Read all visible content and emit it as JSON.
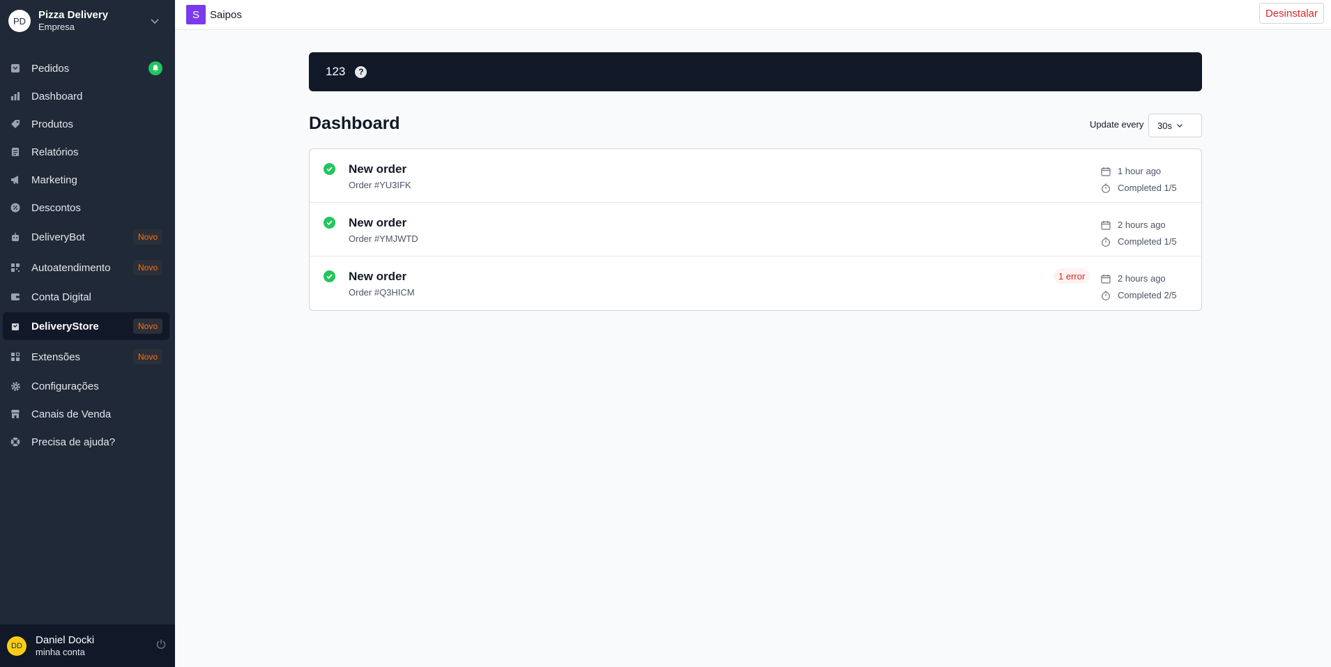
{
  "company": {
    "initials": "PD",
    "name": "Pizza Delivery",
    "subtitle": "Empresa"
  },
  "sidebar": {
    "items": [
      {
        "label": "Pedidos",
        "icon": "inbox-icon",
        "badge": ""
      },
      {
        "label": "Dashboard",
        "icon": "bar-chart-icon",
        "badge": ""
      },
      {
        "label": "Produtos",
        "icon": "tag-icon",
        "badge": ""
      },
      {
        "label": "Relatórios",
        "icon": "document-icon",
        "badge": ""
      },
      {
        "label": "Marketing",
        "icon": "megaphone-icon",
        "badge": ""
      },
      {
        "label": "Descontos",
        "icon": "discount-icon",
        "badge": ""
      },
      {
        "label": "DeliveryBot",
        "icon": "bot-icon",
        "badge": "Novo"
      },
      {
        "label": "Autoatendimento",
        "icon": "qrcode-icon",
        "badge": "Novo"
      },
      {
        "label": "Conta Digital",
        "icon": "wallet-icon",
        "badge": ""
      },
      {
        "label": "DeliveryStore",
        "icon": "store-bag-icon",
        "badge": "Novo"
      },
      {
        "label": "Extensões",
        "icon": "puzzle-icon",
        "badge": "Novo"
      },
      {
        "label": "Configurações",
        "icon": "gear-icon",
        "badge": ""
      },
      {
        "label": "Canais de Venda",
        "icon": "storefront-icon",
        "badge": ""
      },
      {
        "label": "Precisa de ajuda?",
        "icon": "lifebuoy-icon",
        "badge": ""
      }
    ],
    "active_index": 9
  },
  "user": {
    "initials": "DD",
    "name": "Daniel Docki",
    "subtitle": "minha conta"
  },
  "topbar": {
    "app_logo": "S",
    "app_name": "Saipos",
    "uninstall_label": "Desinstalar"
  },
  "banner": {
    "text": "123",
    "help": "?"
  },
  "main": {
    "title": "Dashboard",
    "update_label": "Update every",
    "update_value": "30s"
  },
  "orders": [
    {
      "title": "New order",
      "id": "Order #YU3IFK",
      "time": "1 hour ago",
      "progress": "Completed 1/5",
      "error": ""
    },
    {
      "title": "New order",
      "id": "Order #YMJWTD",
      "time": "2 hours ago",
      "progress": "Completed 1/5",
      "error": ""
    },
    {
      "title": "New order",
      "id": "Order #Q3HICM",
      "time": "2 hours ago",
      "progress": "Completed 2/5",
      "error": "1 error"
    }
  ],
  "colors": {
    "sidebar": "#1f2937",
    "accent_success": "#22c55e",
    "accent_new": "#f97316",
    "danger": "#dc2626",
    "brand": "#7c3aed"
  }
}
